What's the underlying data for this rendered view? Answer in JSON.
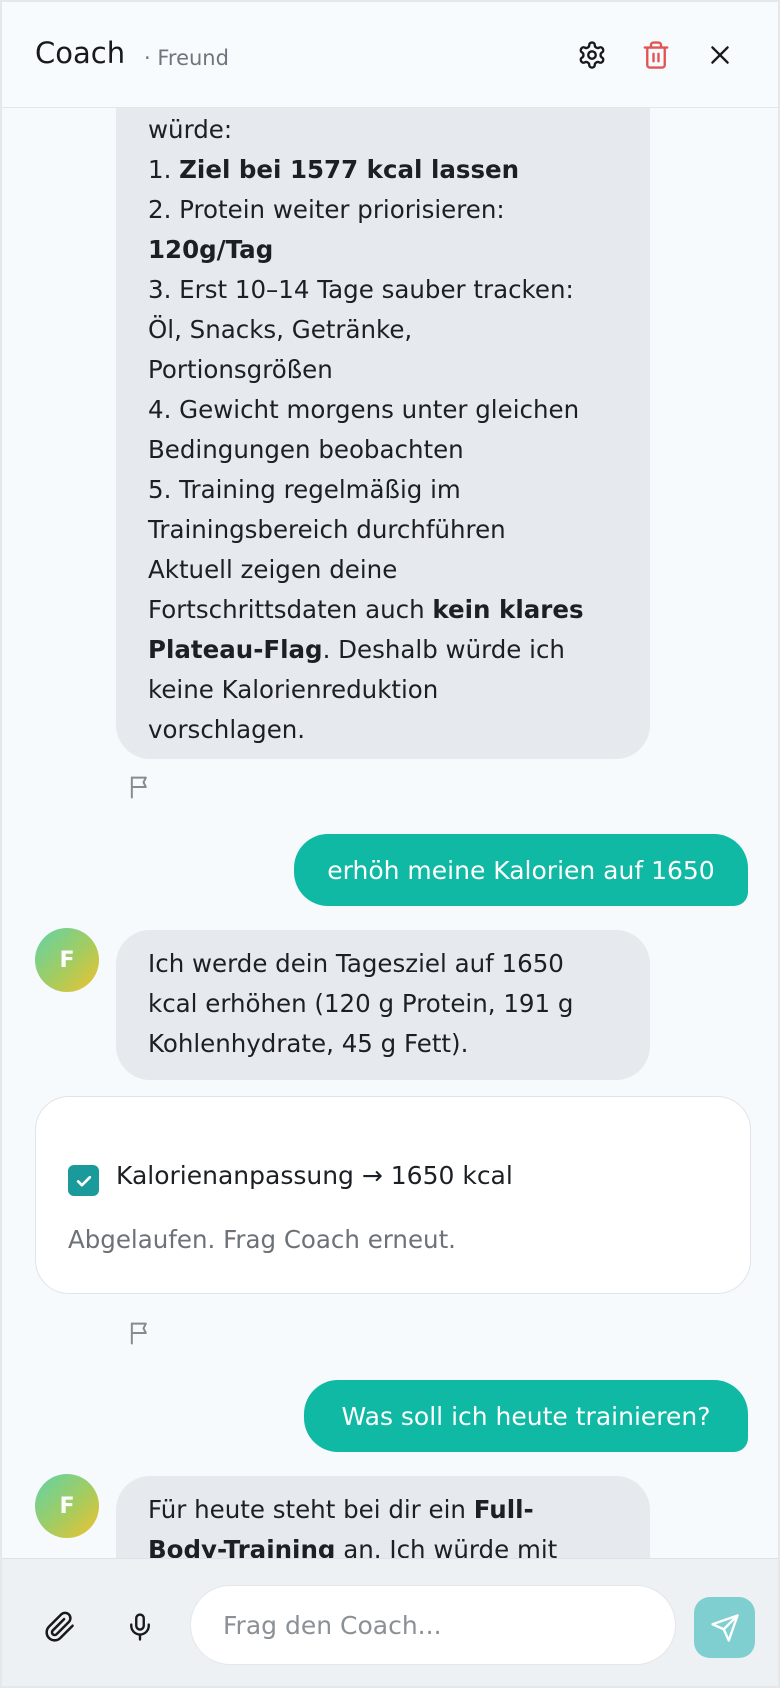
{
  "header": {
    "title": "Coach",
    "subtitle": "· Freund",
    "icons": [
      "gear-icon",
      "trash-icon",
      "close-icon"
    ]
  },
  "messages": {
    "ai_1": {
      "lines": [
        [
          {
            "t": "würde:",
            "b": false
          }
        ],
        [
          {
            "t": "1. ",
            "b": false
          },
          {
            "t": "Ziel bei 1577 kcal lassen",
            "b": true
          }
        ],
        [
          {
            "t": "2. Protein weiter priorisieren:",
            "b": false
          }
        ],
        [
          {
            "t": "120g/Tag",
            "b": true
          }
        ],
        [
          {
            "t": "3. Erst 10–14 Tage sauber tracken:",
            "b": false
          }
        ],
        [
          {
            "t": "Öl, Snacks, Getränke,",
            "b": false
          }
        ],
        [
          {
            "t": "Portionsgrößen",
            "b": false
          }
        ],
        [
          {
            "t": "4. Gewicht morgens unter gleichen",
            "b": false
          }
        ],
        [
          {
            "t": "Bedingungen beobachten",
            "b": false
          }
        ],
        [
          {
            "t": "5. Training regelmäßig im",
            "b": false
          }
        ],
        [
          {
            "t": "Trainingsbereich durchführen",
            "b": false
          }
        ],
        [
          {
            "t": "Aktuell zeigen deine",
            "b": false
          }
        ],
        [
          {
            "t": "Fortschrittsdaten auch ",
            "b": false
          },
          {
            "t": "kein klares",
            "b": true
          }
        ],
        [
          {
            "t": "Plateau-Flag",
            "b": true
          },
          {
            "t": ". Deshalb würde ich",
            "b": false
          }
        ],
        [
          {
            "t": "keine Kalorienreduktion",
            "b": false
          }
        ],
        [
          {
            "t": "vorschlagen.",
            "b": false
          }
        ]
      ]
    },
    "user_1": "erhöh meine Kalorien auf 1650",
    "ai_2": {
      "avatar": "F",
      "lines": [
        [
          {
            "t": "Ich werde dein Tagesziel auf 1650",
            "b": false
          }
        ],
        [
          {
            "t": "kcal erhöhen (120 g Protein, 191 g",
            "b": false
          }
        ],
        [
          {
            "t": "Kohlenhydrate, 45 g Fett).",
            "b": false
          }
        ]
      ]
    },
    "action": {
      "label": "Kalorienanpassung → 1650 kcal",
      "status": "Abgelaufen. Frag Coach erneut.",
      "checked": true
    },
    "user_2": "Was soll ich heute trainieren?",
    "ai_3": {
      "avatar": "F",
      "lines": [
        [
          {
            "t": "Für heute steht bei dir ein ",
            "b": false
          },
          {
            "t": "Full-",
            "b": true
          }
        ],
        [
          {
            "t": "Body-Training",
            "b": true
          },
          {
            "t": " an. Ich würde mit",
            "b": false
          }
        ]
      ]
    }
  },
  "composer": {
    "placeholder": "Frag den Coach...",
    "icons": [
      "paperclip-icon",
      "microphone-icon",
      "send-icon"
    ]
  },
  "colors": {
    "accent": "#10b9a4",
    "ai_bubble": "#e6e9ed",
    "send_button": "#7fcfd1",
    "delete": "#e25555"
  }
}
